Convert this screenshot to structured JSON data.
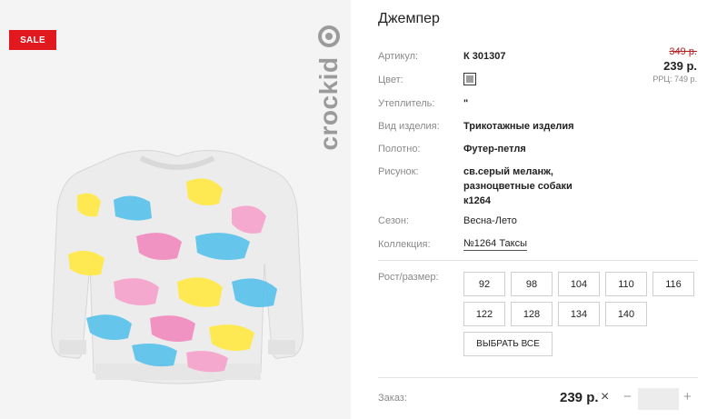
{
  "badge": {
    "sale": "SALE"
  },
  "brand": {
    "name": "crockid"
  },
  "product": {
    "title": "Джемпер",
    "rows": [
      {
        "label": "Артикул:",
        "value": "К 301307"
      },
      {
        "label": "Цвет:",
        "value": ""
      },
      {
        "label": "Утеплитель:",
        "value": "\""
      },
      {
        "label": "Вид изделия:",
        "value": "Трикотажные изделия"
      },
      {
        "label": "Полотно:",
        "value": "Футер-петля"
      },
      {
        "label": "Рисунок:",
        "value": "св.серый меланж, разноцветные собаки к1264"
      },
      {
        "label": "Сезон:",
        "value": "Весна-Лето"
      },
      {
        "label": "Коллекция:",
        "value": "№1264 Таксы"
      }
    ],
    "color_swatch": "#9d9d9d"
  },
  "price": {
    "old": "349 р.",
    "new": "239 р.",
    "rrp": "РРЦ: 749 р.",
    "old_color": "#b32020"
  },
  "sizes": {
    "label": "Рост/размер:",
    "options": [
      "92",
      "98",
      "104",
      "110",
      "116",
      "122",
      "128",
      "134",
      "140"
    ],
    "select_all": "ВЫБРАТЬ ВСЕ"
  },
  "order": {
    "label": "Заказ:",
    "price": "239 р.",
    "times_icon": "×",
    "minus_icon": "−",
    "plus_icon": "+",
    "quantity": ""
  },
  "colors": {
    "sale": "#e2181f",
    "garment_base": "#ececec"
  }
}
